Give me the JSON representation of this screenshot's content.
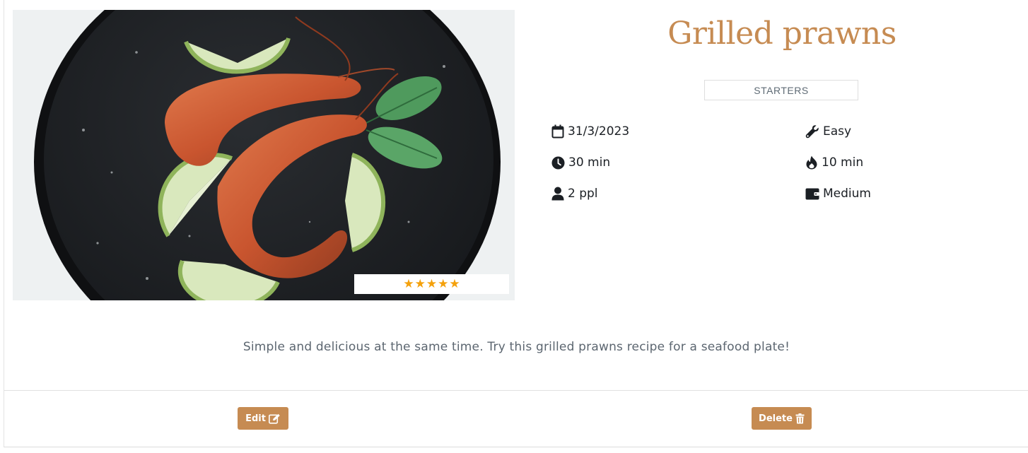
{
  "recipe": {
    "title": "Grilled prawns",
    "category": "STARTERS",
    "rating": 5,
    "rating_max": 5,
    "date": "31/3/2023",
    "difficulty": "Easy",
    "prep_time": "30 min",
    "cook_time": "10 min",
    "servings": "2 ppl",
    "cost": "Medium",
    "description": "Simple and delicious at the same time. Try this grilled prawns recipe for a seafood plate!"
  },
  "actions": {
    "edit_label": "Edit",
    "delete_label": "Delete"
  },
  "icons": {
    "date": "calendar-icon",
    "difficulty": "wrench-icon",
    "prep_time": "clock-icon",
    "cook_time": "flame-icon",
    "servings": "user-icon",
    "cost": "wallet-icon",
    "edit": "edit-icon",
    "delete": "trash-icon",
    "star": "star-icon"
  },
  "colors": {
    "accent": "#c68b52",
    "star": "#f4a10c",
    "text": "#1b1f24",
    "muted": "#5c6670"
  }
}
